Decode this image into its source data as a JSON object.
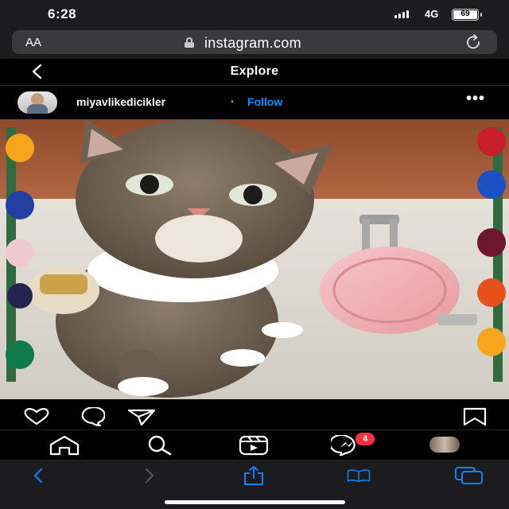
{
  "status": {
    "time": "6:28",
    "network": "4G",
    "battery": "69"
  },
  "browser": {
    "text_size": "AA",
    "domain": "instagram.com"
  },
  "header": {
    "title": "Explore"
  },
  "post": {
    "username": "miyavlikedicikler",
    "separator": "·",
    "follow_label": "Follow",
    "more_label": "•••"
  },
  "nav": {
    "messages_badge": "4"
  },
  "icons": {
    "back": "chevron-left-icon",
    "reload": "reload-icon",
    "like": "heart-icon",
    "comment": "comment-icon",
    "share": "send-icon",
    "save": "bookmark-icon",
    "home": "home-icon",
    "search": "search-icon",
    "reels": "reels-icon",
    "messages": "messenger-icon"
  },
  "colors": {
    "accent": "#0095f6",
    "badge": "#ff3040",
    "safari_tint": "#0a84ff"
  }
}
